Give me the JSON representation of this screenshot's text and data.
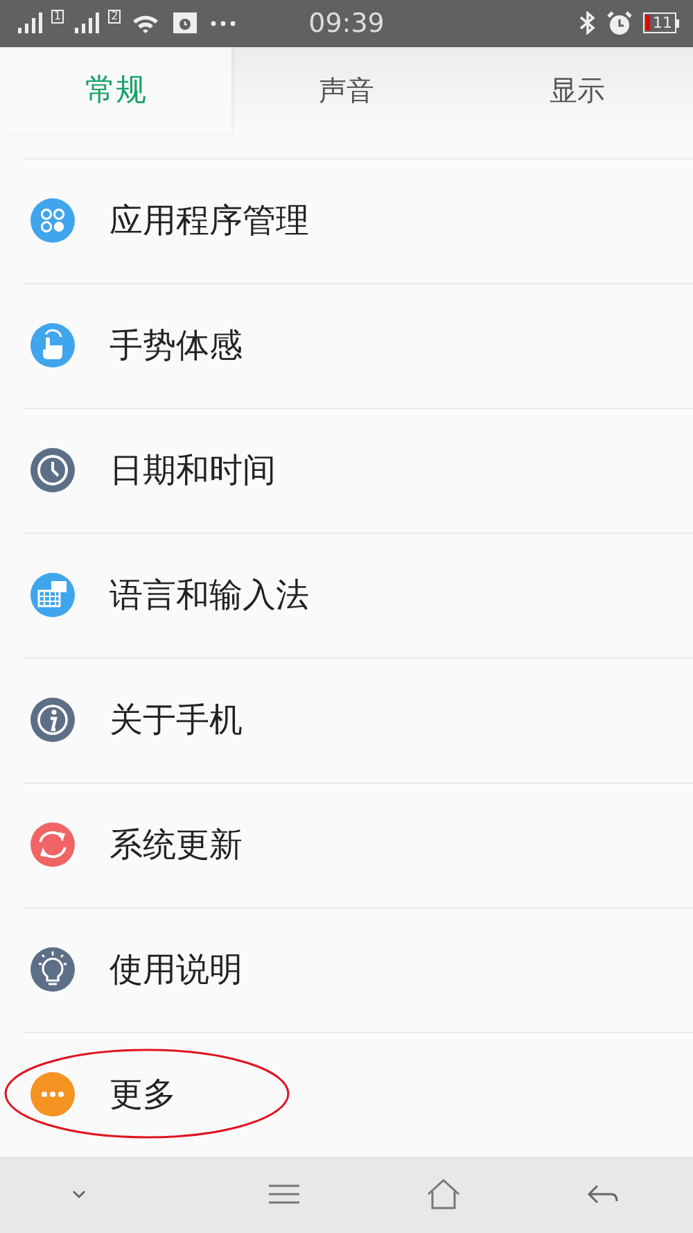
{
  "status_bar": {
    "sim_labels": [
      "1",
      "2"
    ],
    "time": "09:39",
    "battery": "11"
  },
  "tabs": [
    {
      "label": "常规",
      "selected": true
    },
    {
      "label": "声音",
      "selected": false
    },
    {
      "label": "显示",
      "selected": false
    }
  ],
  "items": [
    {
      "kind": "apps",
      "label": "应用程序管理",
      "circled": false
    },
    {
      "kind": "gesture",
      "label": "手势体感",
      "circled": false
    },
    {
      "kind": "clock",
      "label": "日期和时间",
      "circled": false
    },
    {
      "kind": "keyboard",
      "label": "语言和输入法",
      "circled": false
    },
    {
      "kind": "info",
      "label": "关于手机",
      "circled": false
    },
    {
      "kind": "refresh",
      "label": "系统更新",
      "circled": false
    },
    {
      "kind": "bulb",
      "label": "使用说明",
      "circled": false
    },
    {
      "kind": "more",
      "label": "更多",
      "circled": true
    }
  ]
}
